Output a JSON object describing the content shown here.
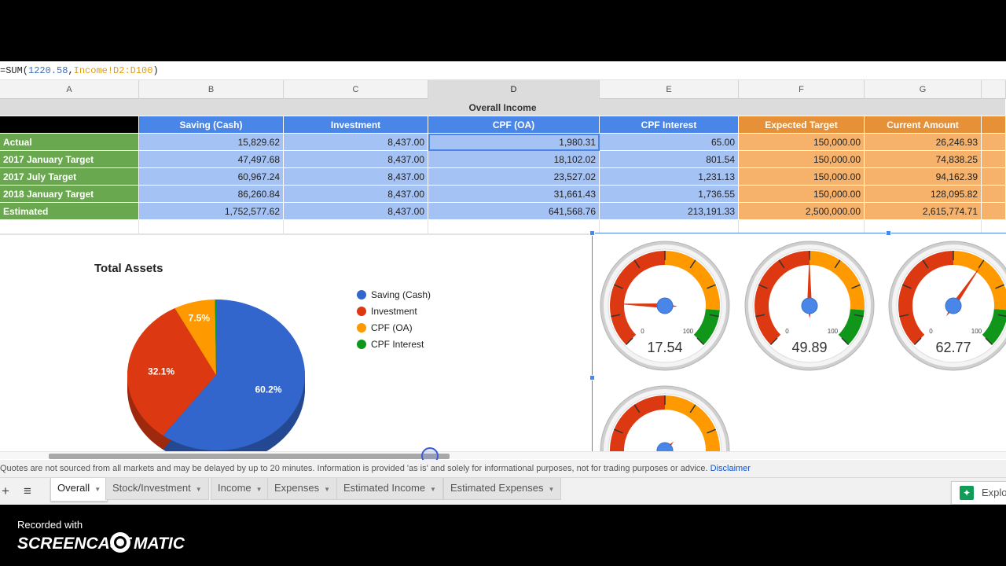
{
  "formula": {
    "prefix": "=SUM(",
    "number": "1220.58",
    "comma": ",",
    "range": "Income!D2:D100",
    "suffix": ")"
  },
  "columns": [
    "A",
    "B",
    "C",
    "D",
    "E",
    "F",
    "G"
  ],
  "selected_column": "D",
  "sheet": {
    "title": "Overall Income",
    "headers": [
      "Saving (Cash)",
      "Investment",
      "CPF (OA)",
      "CPF Interest",
      "Expected Target",
      "Current Amount"
    ],
    "rows": [
      {
        "label": "Actual",
        "values": [
          "15,829.62",
          "8,437.00",
          "1,980.31",
          "65.00",
          "150,000.00",
          "26,246.93"
        ]
      },
      {
        "label": "2017 January Target",
        "values": [
          "47,497.68",
          "8,437.00",
          "18,102.02",
          "801.54",
          "150,000.00",
          "74,838.25"
        ]
      },
      {
        "label": "2017 July Target",
        "values": [
          "60,967.24",
          "8,437.00",
          "23,527.02",
          "1,231.13",
          "150,000.00",
          "94,162.39"
        ]
      },
      {
        "label": "2018 January Target",
        "values": [
          "86,260.84",
          "8,437.00",
          "31,661.43",
          "1,736.55",
          "150,000.00",
          "128,095.82"
        ]
      },
      {
        "label": "Estimated",
        "values": [
          "1,752,577.62",
          "8,437.00",
          "641,568.76",
          "213,191.33",
          "2,500,000.00",
          "2,615,774.71"
        ]
      }
    ]
  },
  "chart_data": [
    {
      "type": "pie",
      "title": "Total Assets",
      "categories": [
        "Saving (Cash)",
        "Investment",
        "CPF (OA)",
        "CPF Interest"
      ],
      "values": [
        60.2,
        32.1,
        7.5,
        0.2
      ],
      "labels": [
        "60.2%",
        "32.1%",
        "7.5%",
        ""
      ],
      "colors": [
        "#3366cc",
        "#dc3912",
        "#ff9900",
        "#109618"
      ],
      "legend": "right"
    },
    {
      "type": "gauge",
      "min_label": "0",
      "max_label": "100",
      "values": [
        17.54,
        49.89,
        62.77,
        0
      ],
      "value_labels": [
        "17.54",
        "49.89",
        "62.77",
        ""
      ],
      "bands": [
        {
          "color": "#dc3912",
          "from": 0,
          "to": 50
        },
        {
          "color": "#ff9900",
          "from": 50,
          "to": 85
        },
        {
          "color": "#109618",
          "from": 85,
          "to": 100
        }
      ]
    }
  ],
  "disclaimer": {
    "text": "Quotes are not sourced from all markets and may be delayed by up to 20 minutes. Information is provided 'as is' and solely for informational purposes, not for trading purposes or advice.",
    "link": "Disclaimer"
  },
  "tabs": [
    {
      "label": "Overall",
      "active": true
    },
    {
      "label": "Stock/Investment",
      "active": false
    },
    {
      "label": "Income",
      "active": false
    },
    {
      "label": "Expenses",
      "active": false
    },
    {
      "label": "Estimated Income",
      "active": false
    },
    {
      "label": "Estimated Expenses",
      "active": false
    }
  ],
  "toolbar": {
    "add_icon": "+",
    "list_icon": "≡",
    "explore_label": "Explore"
  },
  "watermark": {
    "recorded_with": "Recorded with",
    "brand_left": "SCREENCAST",
    "brand_right": "MATIC"
  }
}
